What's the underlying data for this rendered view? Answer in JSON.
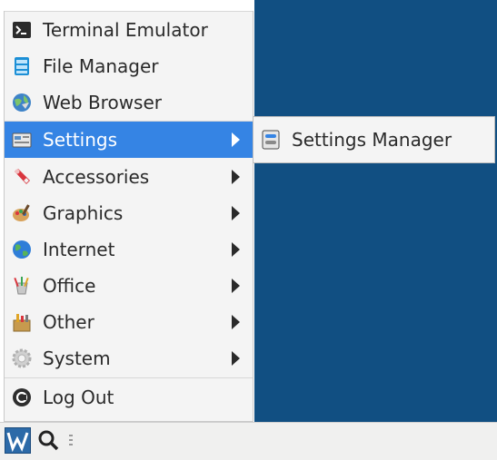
{
  "menu": {
    "items": [
      {
        "label": "Terminal Emulator",
        "icon": "terminal-icon"
      },
      {
        "label": "File Manager",
        "icon": "file-manager-icon"
      },
      {
        "label": "Web Browser",
        "icon": "web-browser-icon"
      },
      {
        "label": "Settings",
        "icon": "settings-icon",
        "has_submenu": true,
        "active": true
      },
      {
        "label": "Accessories",
        "icon": "accessories-icon",
        "has_submenu": true
      },
      {
        "label": "Graphics",
        "icon": "graphics-icon",
        "has_submenu": true
      },
      {
        "label": "Internet",
        "icon": "internet-icon",
        "has_submenu": true
      },
      {
        "label": "Office",
        "icon": "office-icon",
        "has_submenu": true
      },
      {
        "label": "Other",
        "icon": "other-icon",
        "has_submenu": true
      },
      {
        "label": "System",
        "icon": "system-icon",
        "has_submenu": true
      },
      {
        "label": "Log Out",
        "icon": "log-out-icon"
      }
    ]
  },
  "submenu": {
    "items": [
      {
        "label": "Settings Manager",
        "icon": "settings-manager-icon"
      }
    ]
  },
  "colors": {
    "highlight": "#3584e4",
    "desktop": "#114f82",
    "menu_background": "#f4f4f4"
  }
}
